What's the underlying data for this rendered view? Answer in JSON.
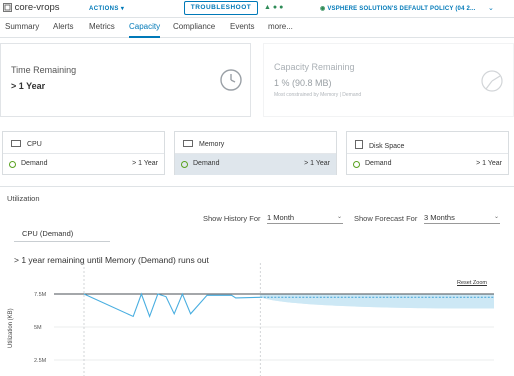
{
  "header": {
    "app_name": "core-vrops",
    "actions_label": "ACTIONS",
    "troubleshoot_label": "TROUBLESHOOT",
    "policy_label": "VSPHERE SOLUTION'S DEFAULT POLICY (04 2..."
  },
  "tabs": [
    {
      "label": "Summary",
      "active": false
    },
    {
      "label": "Alerts",
      "active": false
    },
    {
      "label": "Metrics",
      "active": false
    },
    {
      "label": "Capacity",
      "active": true
    },
    {
      "label": "Compliance",
      "active": false
    },
    {
      "label": "Events",
      "active": false
    },
    {
      "label": "more...",
      "active": false
    }
  ],
  "time_remaining": {
    "title": "Time Remaining",
    "value": "> 1 Year",
    "icon": "clock-icon"
  },
  "capacity_remaining": {
    "title": "Capacity Remaining",
    "value": "1 % (90.8 MB)",
    "note": "Most constrained by Memory | Demand",
    "icon": "pie-chart-icon"
  },
  "resources": [
    {
      "name": "CPU",
      "metric": "Demand",
      "value": "> 1 Year",
      "selected": false,
      "icon": "cpu-icon"
    },
    {
      "name": "Memory",
      "metric": "Demand",
      "value": "> 1 Year",
      "selected": true,
      "icon": "memory-icon"
    },
    {
      "name": "Disk Space",
      "metric": "Demand",
      "value": "> 1 Year",
      "selected": false,
      "icon": "disk-icon"
    }
  ],
  "utilization": {
    "section_title": "Utilization",
    "history_label": "Show History For",
    "history_value": "1 Month",
    "forecast_label": "Show Forecast For",
    "forecast_value": "3 Months",
    "metric_selected": "CPU (Demand)",
    "remaining_text": "> 1 year remaining until Memory (Demand) runs out",
    "reset_zoom": "Reset Zoom"
  },
  "colors": {
    "accent": "#0079b8",
    "ok_green": "#5aa220",
    "series_line": "#49aee0",
    "forecast_band": "#cbe7f5"
  },
  "chart_data": {
    "type": "line",
    "ylabel": "Utilization (KB)",
    "yticks": [
      "7.5M",
      "5M",
      "2.5M"
    ],
    "ylim": [
      0,
      8500000
    ],
    "xlim": [
      0,
      100
    ],
    "capacity_line": 7500000,
    "series": [
      {
        "name": "",
        "x": [
          0,
          12,
          14,
          16,
          18,
          20,
          22,
          24,
          26,
          30,
          36,
          37,
          43
        ],
        "values": [
          7500000,
          5800000,
          7500000,
          5800000,
          7500000,
          7300000,
          6000000,
          7500000,
          6000000,
          7400000,
          7400000,
          7200000,
          7250000
        ]
      }
    ],
    "forecast": {
      "x_start": 43,
      "x_end": 100,
      "center": 7250000,
      "upper": [
        7500000,
        7500000
      ],
      "lower_start": 7000000,
      "lower_end": 6400000
    }
  }
}
